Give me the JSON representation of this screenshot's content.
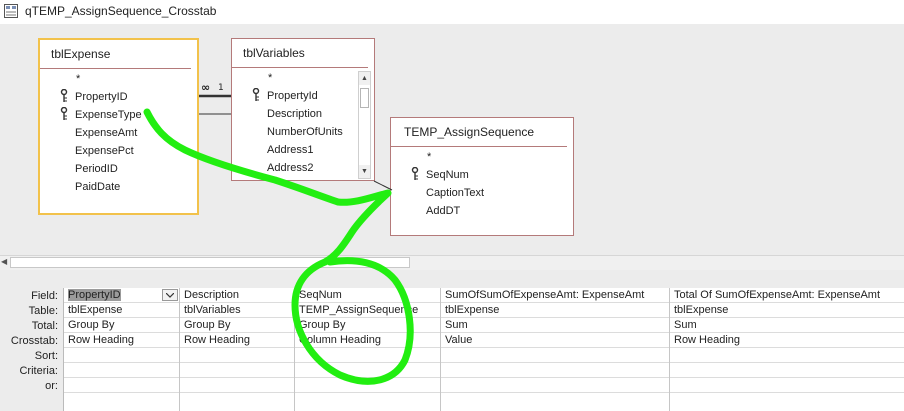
{
  "window": {
    "title": "qTEMP_AssignSequence_Crosstab"
  },
  "tables": [
    {
      "name": "tblExpense",
      "fields": [
        "*",
        "PropertyID",
        "ExpenseType",
        "ExpenseAmt",
        "ExpensePct",
        "PeriodID",
        "PaidDate"
      ]
    },
    {
      "name": "tblVariables",
      "fields": [
        "*",
        "PropertyId",
        "Description",
        "NumberOfUnits",
        "Address1",
        "Address2"
      ]
    },
    {
      "name": "TEMP_AssignSequence",
      "fields": [
        "*",
        "SeqNum",
        "CaptionText",
        "AddDT"
      ]
    }
  ],
  "join": {
    "one_side": "1",
    "many_side": "∞"
  },
  "grid": {
    "row_labels": [
      "Field:",
      "Table:",
      "Total:",
      "Crosstab:",
      "Sort:",
      "Criteria:",
      "or:"
    ],
    "columns": [
      {
        "field": "PropertyID",
        "table": "tblExpense",
        "total": "Group By",
        "crosstab": "Row Heading"
      },
      {
        "field": "Description",
        "table": "tblVariables",
        "total": "Group By",
        "crosstab": "Row Heading"
      },
      {
        "field": "SeqNum",
        "table": "TEMP_AssignSequence",
        "total": "Group By",
        "crosstab": "Column Heading"
      },
      {
        "field": "SumOfSumOfExpenseAmt: ExpenseAmt",
        "table": "tblExpense",
        "total": "Sum",
        "crosstab": "Value"
      },
      {
        "field": "Total Of SumOfExpenseAmt: ExpenseAmt",
        "table": "tblExpense",
        "total": "Sum",
        "crosstab": "Row Heading"
      }
    ]
  },
  "colors": {
    "table_border": "#b47a7a",
    "selected_border": "#f2c24b",
    "annotation": "#22ee11"
  }
}
